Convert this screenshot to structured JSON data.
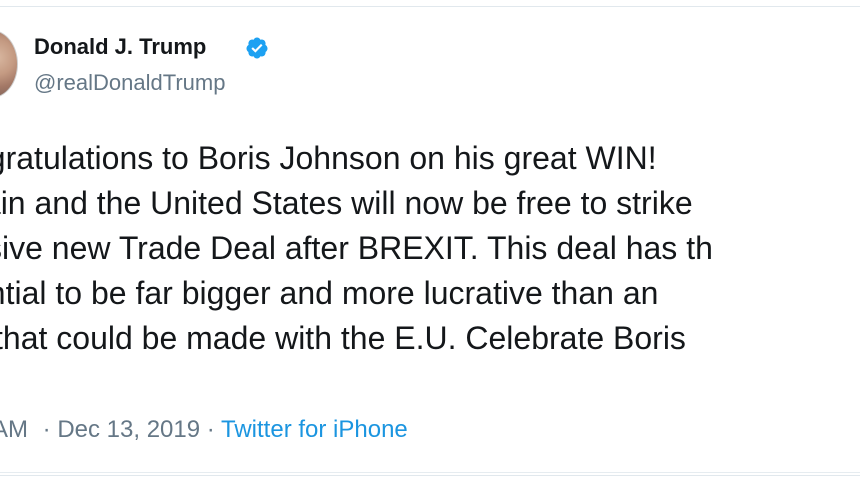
{
  "tweet": {
    "author": {
      "display_name": "Donald J. Trump",
      "handle": "@realDonaldTrump",
      "verified": true,
      "verified_color": "#1da1f2"
    },
    "text_lines": [
      "ngratulations to Boris Johnson on his great WIN!",
      "tain and the United States will now be free to strike",
      "ssive new Trade Deal after BREXIT. This deal has th",
      "ential to be far bigger and more lucrative than an",
      "l that could be made with the E.U. Celebrate Boris"
    ],
    "meta": {
      "time": "AM",
      "separator_1": " · ",
      "date": "Dec 13, 2019",
      "separator_2": " · ",
      "source": "Twitter for iPhone"
    }
  },
  "colors": {
    "text": "#14171a",
    "secondary": "#657786",
    "link": "#1b95e0",
    "border": "#e1e8ed"
  }
}
